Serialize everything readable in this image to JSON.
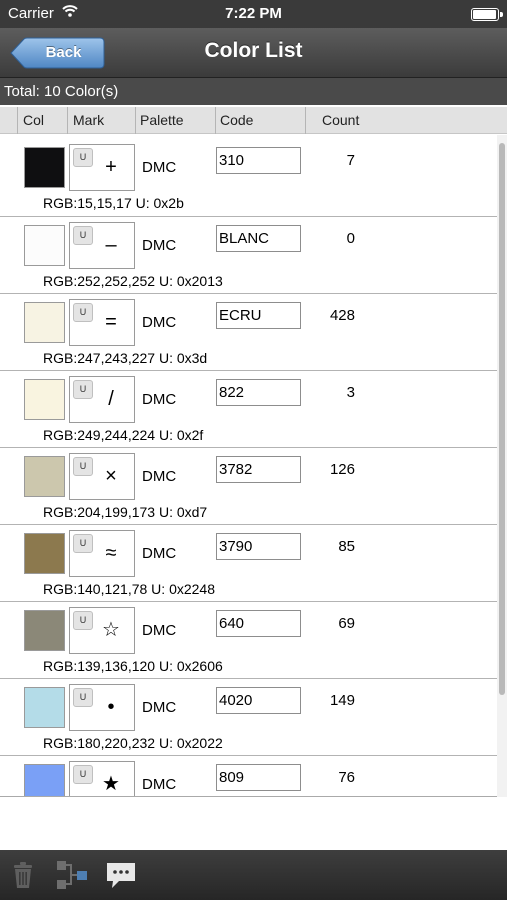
{
  "status_bar": {
    "carrier": "Carrier",
    "time": "7:22 PM",
    "battery_level": 1.0
  },
  "nav": {
    "back_label": "Back",
    "title": "Color List"
  },
  "total": "Total: 10 Color(s)",
  "headers": {
    "col": "Col",
    "mark": "Mark",
    "palette": "Palette",
    "code": "Code",
    "count": "Count"
  },
  "rows": [
    {
      "color": "#0f0f11",
      "u": "U",
      "mark": "+",
      "palette": "DMC",
      "code": "310",
      "count": "7",
      "rgb": "RGB:15,15,17 U: 0x2b"
    },
    {
      "color": "#fcfcfc",
      "u": "U",
      "mark": "–",
      "palette": "DMC",
      "code": "BLANC",
      "count": "0",
      "rgb": "RGB:252,252,252 U: 0x2013"
    },
    {
      "color": "#f7f3e3",
      "u": "U",
      "mark": "=",
      "palette": "DMC",
      "code": "ECRU",
      "count": "428",
      "rgb": "RGB:247,243,227 U: 0x3d"
    },
    {
      "color": "#f9f4e0",
      "u": "U",
      "mark": "/",
      "palette": "DMC",
      "code": "822",
      "count": "3",
      "rgb": "RGB:249,244,224 U: 0x2f"
    },
    {
      "color": "#ccc7ad",
      "u": "U",
      "mark": "×",
      "palette": "DMC",
      "code": "3782",
      "count": "126",
      "rgb": "RGB:204,199,173 U: 0xd7"
    },
    {
      "color": "#8c794e",
      "u": "U",
      "mark": "≈",
      "palette": "DMC",
      "code": "3790",
      "count": "85",
      "rgb": "RGB:140,121,78 U: 0x2248"
    },
    {
      "color": "#8b8878",
      "u": "U",
      "mark": "☆",
      "palette": "DMC",
      "code": "640",
      "count": "69",
      "rgb": "RGB:139,136,120 U: 0x2606"
    },
    {
      "color": "#b4dce8",
      "u": "U",
      "mark": "•",
      "palette": "DMC",
      "code": "4020",
      "count": "149",
      "rgb": "RGB:180,220,232 U: 0x2022"
    },
    {
      "color": "#7aa0f6",
      "u": "U",
      "mark": "★",
      "palette": "DMC",
      "code": "809",
      "count": "76",
      "rgb": ""
    }
  ],
  "toolbar": {
    "icons": [
      "trash-icon",
      "hierarchy-icon",
      "comment-icon"
    ]
  }
}
